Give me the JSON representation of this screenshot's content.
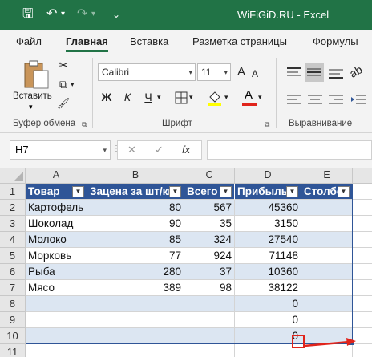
{
  "window": {
    "title": "WiFiGiD.RU  -  Excel",
    "qa_save": "🖫",
    "qa_undo": "↶",
    "qa_redo": "↷",
    "qa_more": "⌄"
  },
  "ribbon_tabs": [
    "Файл",
    "Главная",
    "Вставка",
    "Разметка страницы",
    "Формулы"
  ],
  "active_tab_index": 1,
  "ribbon": {
    "clipboard": {
      "paste_label": "Вставить",
      "group_label": "Буфер обмена",
      "cut_icon": "✂",
      "copy_icon": "⧉",
      "painter_icon": "🖌"
    },
    "font": {
      "font_name": "Calibri",
      "font_size": "11",
      "bold": "Ж",
      "italic": "К",
      "underline": "Ч",
      "group_label": "Шрифт",
      "grow": "A",
      "shrink": "A"
    },
    "alignment": {
      "group_label": "Выравнивание"
    }
  },
  "formula_bar": {
    "name_box": "H7",
    "cancel": "✕",
    "enter": "✓",
    "fx": "fx",
    "value": ""
  },
  "grid": {
    "columns": [
      "A",
      "B",
      "C",
      "D",
      "E"
    ],
    "rows": [
      "1",
      "2",
      "3",
      "4",
      "5",
      "6",
      "7",
      "8",
      "9",
      "10",
      "11"
    ],
    "header": [
      "Товар",
      "Зацена за шт/кг",
      "Всего",
      "Прибыль",
      "Столбе"
    ],
    "data": [
      [
        "Картофель",
        "80",
        "567",
        "45360",
        ""
      ],
      [
        "Шоколад",
        "90",
        "35",
        "3150",
        ""
      ],
      [
        "Молоко",
        "85",
        "324",
        "27540",
        ""
      ],
      [
        "Морковь",
        "77",
        "924",
        "71148",
        ""
      ],
      [
        "Рыба",
        "280",
        "37",
        "10360",
        ""
      ],
      [
        "Мясо",
        "389",
        "98",
        "38122",
        ""
      ],
      [
        "",
        "",
        "",
        "0",
        ""
      ],
      [
        "",
        "",
        "",
        "0",
        ""
      ],
      [
        "",
        "",
        "",
        "0",
        ""
      ]
    ]
  },
  "colors": {
    "excel_green": "#217346",
    "table_header": "#2f5597",
    "band": "#dce6f2",
    "annotation_red": "#e0241b"
  }
}
